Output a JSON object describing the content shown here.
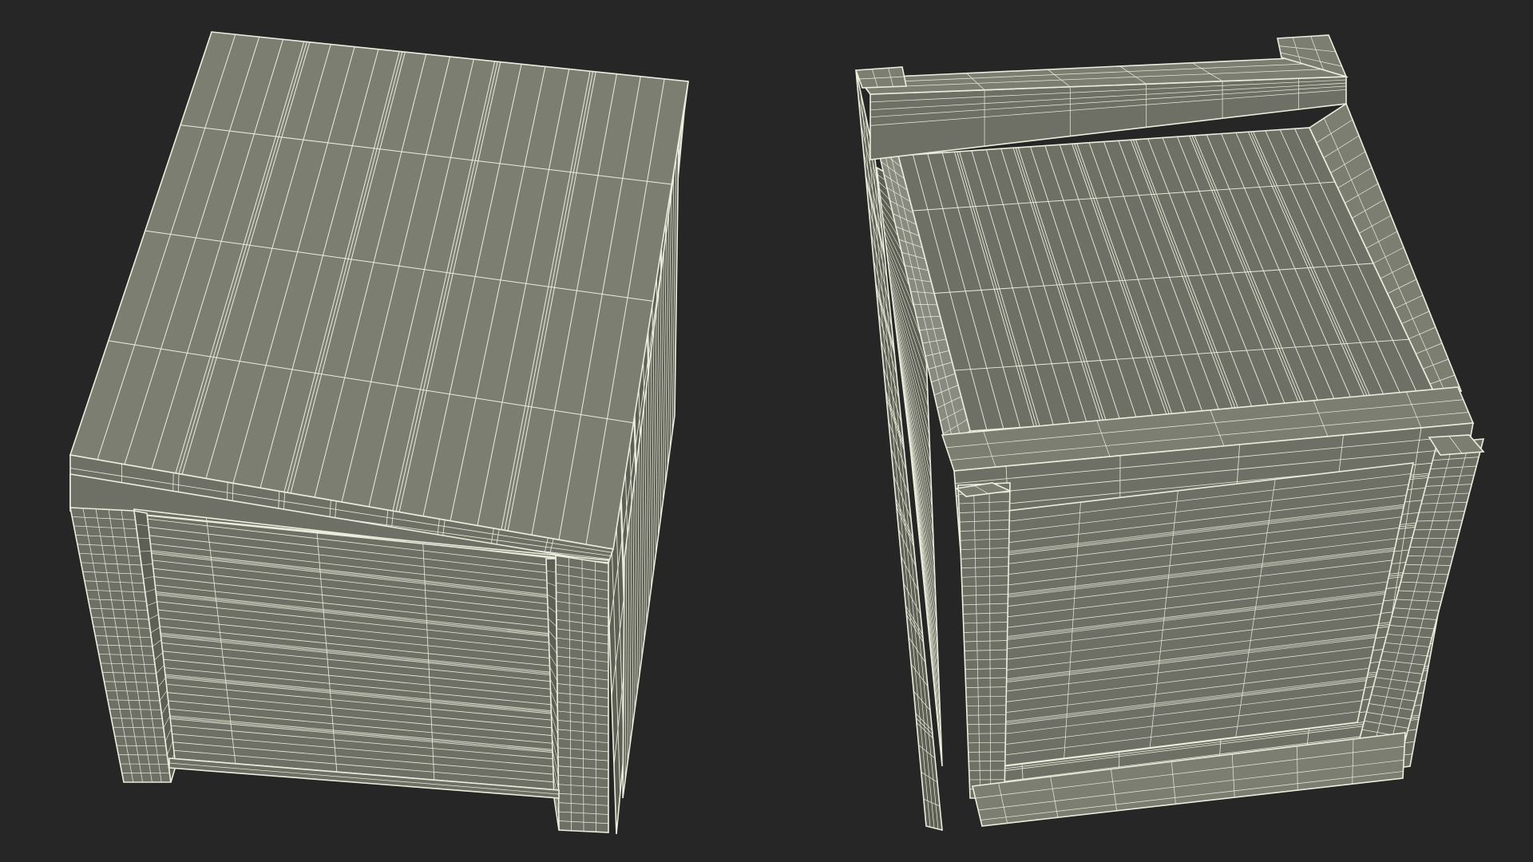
{
  "colors": {
    "background": "#262626",
    "face_top": "#7d7e72",
    "face_side": "#6f7065",
    "face_dark": "#5e5f55",
    "face_light": "#8a8b80",
    "wire": "#eceedd"
  },
  "viewport": {
    "objects": [
      {
        "name": "crate-top-view",
        "view": "top"
      },
      {
        "name": "crate-bottom-view",
        "view": "bottom"
      }
    ]
  }
}
